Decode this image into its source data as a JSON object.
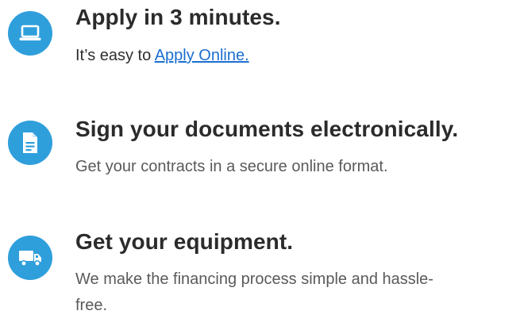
{
  "colors": {
    "icon_bg": "#2f9fdc",
    "title_text": "#2b2b2b",
    "body_text": "#5a5a5a",
    "link": "#1a6fd0"
  },
  "steps": [
    {
      "icon": "laptop-icon",
      "title": "Apply in 3 minutes.",
      "desc_prefix": "It’s easy to ",
      "link_text": "Apply Online."
    },
    {
      "icon": "document-icon",
      "title": "Sign your documents electronically.",
      "desc": "Get your contracts in a secure online format."
    },
    {
      "icon": "truck-icon",
      "title": "Get your equipment.",
      "desc": "We make the financing process simple and hassle-free."
    }
  ]
}
